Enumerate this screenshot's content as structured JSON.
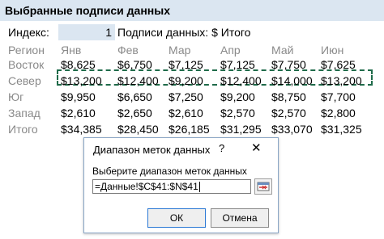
{
  "sheet": {
    "title": "Выбранные подписи данных",
    "index_label": "Индекс:",
    "index_value": "1",
    "caption_label": "Подписи данных: $ Итого",
    "region_header": "Регион",
    "months": [
      "Янв",
      "Фев",
      "Мар",
      "Апр",
      "Май",
      "Июн"
    ],
    "rows": [
      {
        "region": "Восток",
        "values": [
          "$8,625",
          "$6,750",
          "$7,125",
          "$7,125",
          "$7,750",
          "$7,625"
        ]
      },
      {
        "region": "Север",
        "values": [
          "$13,200",
          "$12,400",
          "$9,200",
          "$12,400",
          "$14,000",
          "$13,200"
        ]
      },
      {
        "region": "Юг",
        "values": [
          "$9,950",
          "$6,650",
          "$7,250",
          "$9,200",
          "$8,750",
          "$7,700"
        ]
      },
      {
        "region": "Запад",
        "values": [
          "$2,610",
          "$2,650",
          "$2,610",
          "$2,570",
          "$2,570",
          "$2,800"
        ]
      },
      {
        "region": "Итого",
        "values": [
          "$34,385",
          "$28,450",
          "$26,185",
          "$31,295",
          "$33,070",
          "$31,325"
        ]
      }
    ]
  },
  "dialog": {
    "title": "Диапазон меток данных",
    "help": "?",
    "close": "✕",
    "prompt": "Выберите диапазон меток данных",
    "range_value": "=Данные!$C$41:$N$41",
    "ok_label": "ОК",
    "cancel_label": "Отмена"
  },
  "colors": {
    "header_fill": "#dbe6f1",
    "marquee": "#1f6b4a",
    "muted_text": "#8a8a8a"
  }
}
